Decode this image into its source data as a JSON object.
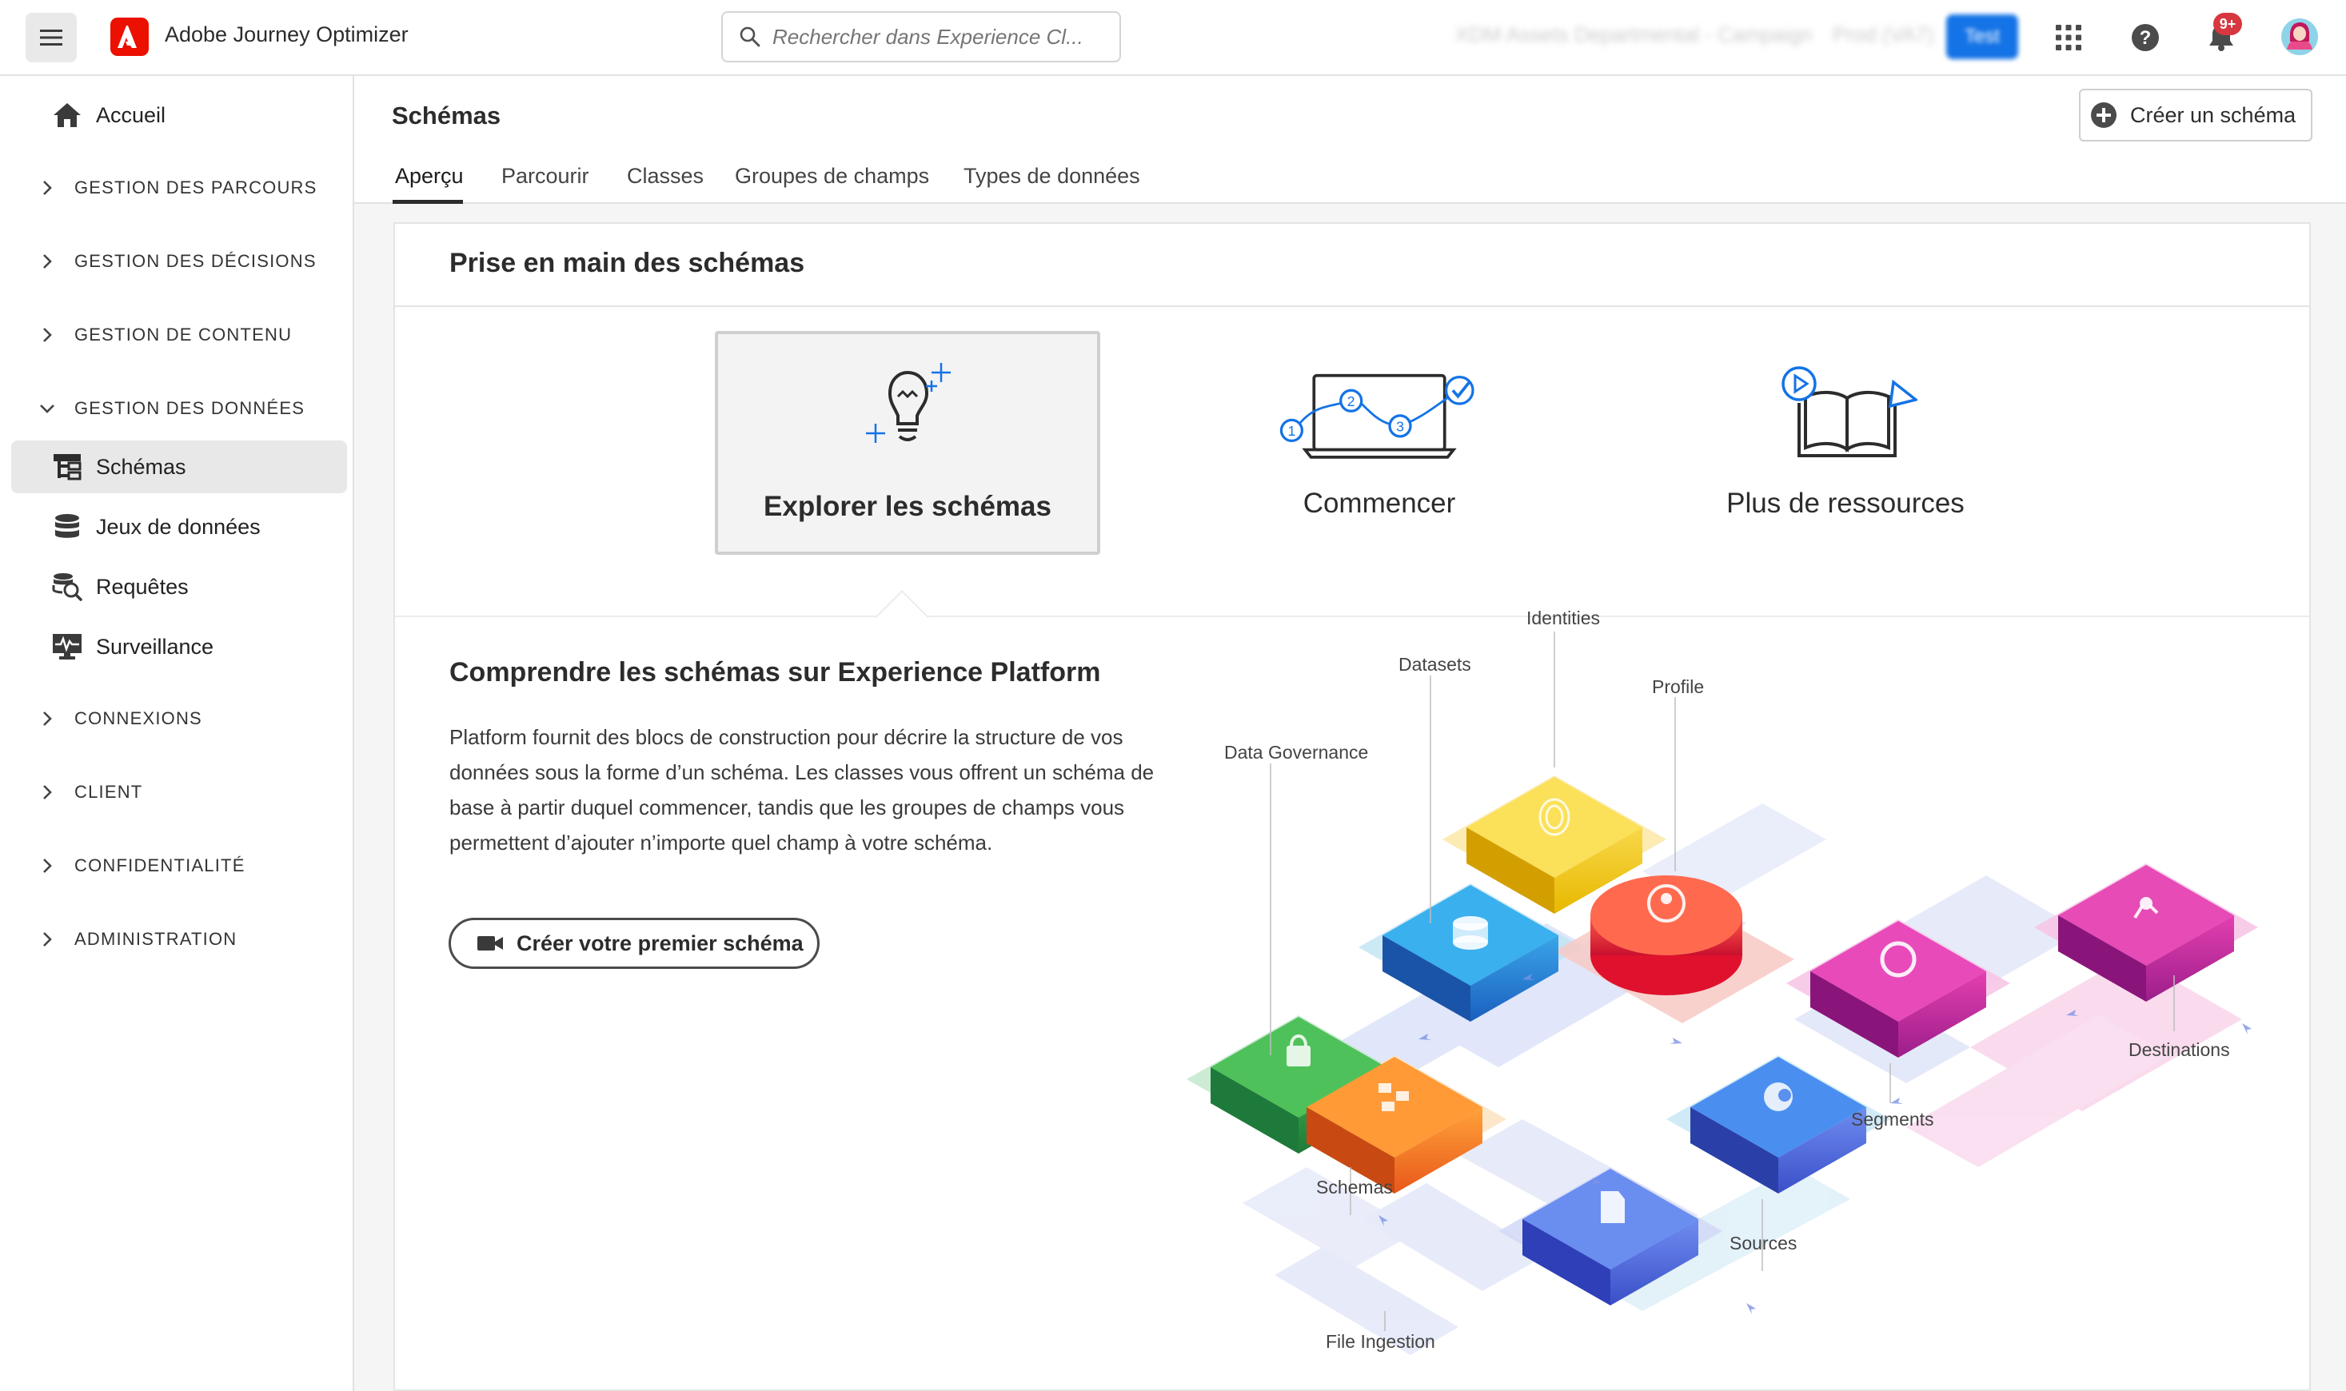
{
  "app": {
    "title": "Adobe Journey Optimizer",
    "search_placeholder": "Rechercher dans Experience Cl...",
    "org_name": "XDM Assets Departmental - Campaign",
    "sandbox_name": "Prod (VA7)",
    "env_badge": "Test",
    "notification_count": "9+"
  },
  "sidebar": {
    "home_label": "Accueil",
    "items": [
      {
        "type": "section",
        "label": "GESTION DES PARCOURS",
        "expanded": false
      },
      {
        "type": "section",
        "label": "GESTION DES DÉCISIONS",
        "expanded": false
      },
      {
        "type": "section",
        "label": "GESTION DE CONTENU",
        "expanded": false
      },
      {
        "type": "section",
        "label": "GESTION DES DONNÉES",
        "expanded": true
      },
      {
        "type": "item",
        "label": "Schémas",
        "icon": "schema-icon",
        "active": true
      },
      {
        "type": "item",
        "label": "Jeux de données",
        "icon": "database-icon"
      },
      {
        "type": "item",
        "label": "Requêtes",
        "icon": "query-icon"
      },
      {
        "type": "item",
        "label": "Surveillance",
        "icon": "monitoring-icon"
      },
      {
        "type": "section",
        "label": "CONNEXIONS",
        "expanded": false
      },
      {
        "type": "section",
        "label": "CLIENT",
        "expanded": false
      },
      {
        "type": "section",
        "label": "CONFIDENTIALITÉ",
        "expanded": false
      },
      {
        "type": "section",
        "label": "ADMINISTRATION",
        "expanded": false
      }
    ]
  },
  "main": {
    "title": "Schémas",
    "create_button": "Créer un schéma",
    "tabs": [
      {
        "label": "Aperçu",
        "active": true
      },
      {
        "label": "Parcourir"
      },
      {
        "label": "Classes"
      },
      {
        "label": "Groupes de champs"
      },
      {
        "label": "Types de données"
      }
    ],
    "card": {
      "title": "Prise en main des schémas",
      "options": [
        {
          "label": "Explorer les schémas",
          "icon": "lightbulb-icon",
          "selected": true
        },
        {
          "label": "Commencer",
          "icon": "laptop-steps-icon"
        },
        {
          "label": "Plus de ressources",
          "icon": "book-resources-icon"
        }
      ],
      "intro_title": "Comprendre les schémas sur Experience Platform",
      "intro_text": "Platform fournit des blocs de construction pour décrire la structure de vos données sous la forme d’un schéma. Les classes vous offrent un schéma de base à partir duquel commencer, tandis que les groupes de champs vous permettent d’ajouter n’importe quel champ à votre schéma.",
      "cta_label": "Créer votre premier schéma"
    },
    "diagram_labels": {
      "identities": "Identities",
      "datasets": "Datasets",
      "profile": "Profile",
      "data_governance": "Data Governance",
      "destinations": "Destinations",
      "segments": "Segments",
      "schemas": "Schemas",
      "sources": "Sources",
      "file_ingestion": "File Ingestion"
    }
  },
  "colors": {
    "accent": "#1473e6",
    "adobe_red": "#eb1000",
    "badge_red": "#d7373f"
  }
}
